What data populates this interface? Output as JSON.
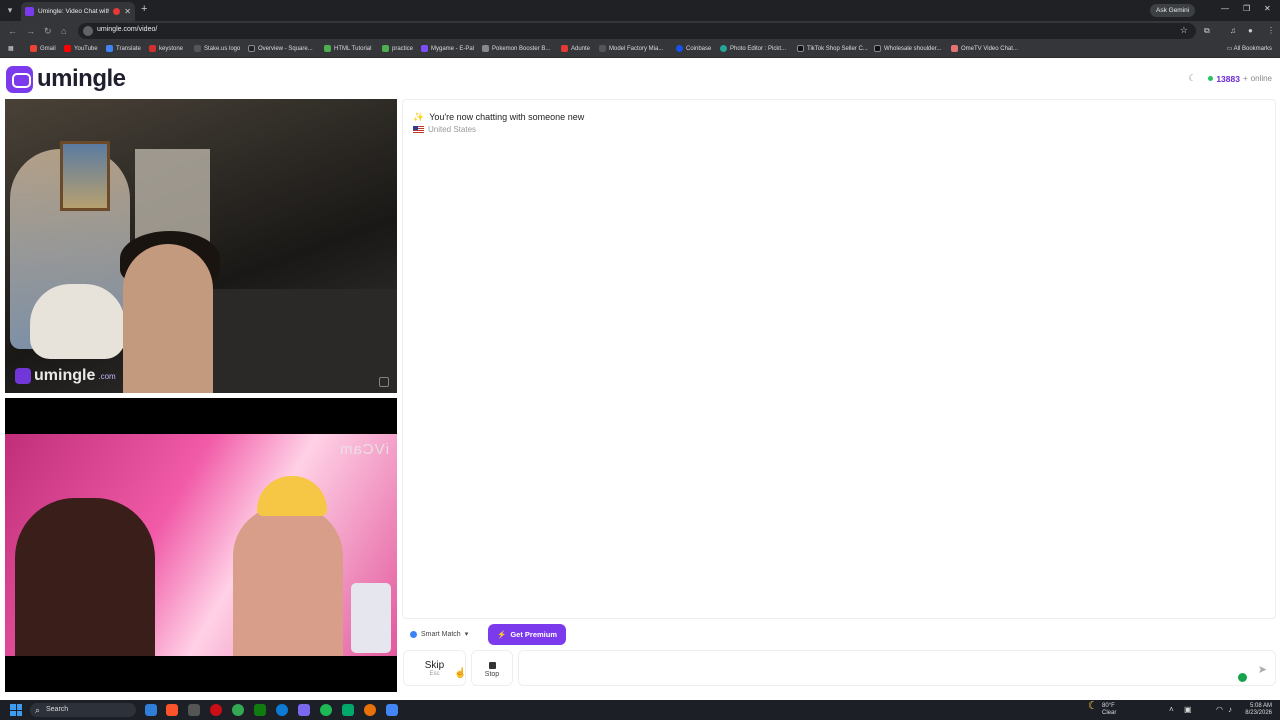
{
  "browser": {
    "tab_title": "Umingle: Video Chat with S",
    "url": "umingle.com/video/",
    "ask_gemini": "Ask Gemini",
    "all_bookmarks": "All Bookmarks",
    "bookmarks": [
      "Gmail",
      "YouTube",
      "Translate",
      "keystone",
      "Stake.us logo",
      "Overview - Square...",
      "HTML Tutorial",
      "practice",
      "Mygame - E-Pal",
      "Pokemon Booster B...",
      "Adunte",
      "Model Factory Mia...",
      "Coinbase",
      "Photo Editor : Pickt...",
      "TikTok Shop Seller C...",
      "Wholesale shoulder...",
      "OmeTV Video Chat..."
    ]
  },
  "site": {
    "logo_text": "umingle",
    "online_count": "13883",
    "online_plus": "+",
    "online_label": "online"
  },
  "videos": {
    "watermark": "umingle",
    "watermark_com": ".com",
    "self_cam_label": "iVCam"
  },
  "chat": {
    "system_message": "You're now chatting with someone new",
    "country": "United States"
  },
  "controls": {
    "smart_match": "Smart Match",
    "premium": "Get Premium",
    "skip_label": "Skip",
    "skip_shortcut": "Esc",
    "stop_label": "Stop"
  },
  "taskbar": {
    "search": "Search",
    "weather_temp": "80°F",
    "weather_desc": "Clear",
    "time": "5:08 AM",
    "date": "8/23/2026"
  },
  "colors": {
    "brand": "#7c3aed",
    "online_dot": "#22c55e"
  }
}
